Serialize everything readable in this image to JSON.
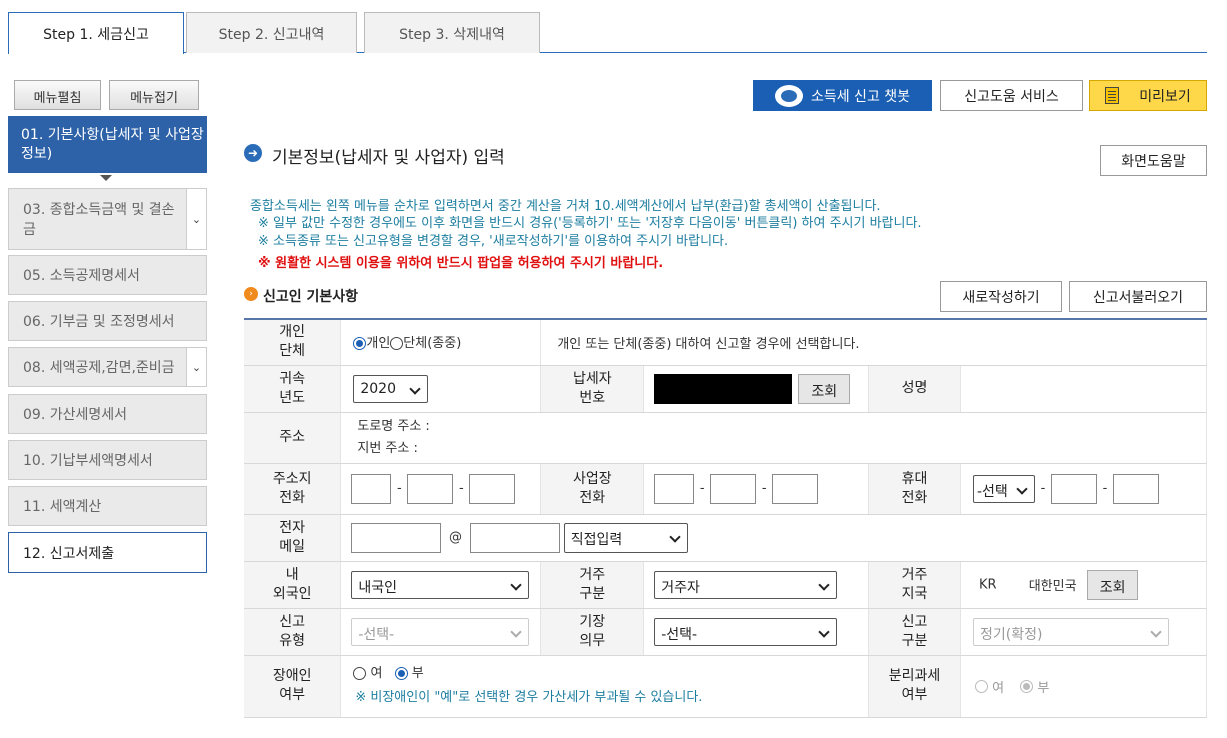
{
  "tabs": [
    "Step 1. 세금신고",
    "Step 2. 신고내역",
    "Step 3. 삭제내역"
  ],
  "menu_controls": {
    "expand": "메뉴펼침",
    "collapse": "메뉴접기"
  },
  "left_menu": [
    "01. 기본사항(납세자 및 사업장정보)",
    "03. 종합소득금액 및 결손금",
    "05. 소득공제명세서",
    "06. 기부금 및 조정명세서",
    "08. 세액공제,감면,준비금",
    "09. 가산세명세서",
    "10. 기납부세액명세서",
    "11. 세액계산",
    "12. 신고서제출"
  ],
  "top_buttons": {
    "chatbot": "소득세 신고 챗봇",
    "help_service": "신고도움 서비스",
    "preview": "미리보기"
  },
  "page_title": "기본정보(납세자 및 사업자) 입력",
  "screen_help": "화면도움말",
  "info_lines": [
    "종합소득세는 왼쪽 메뉴를 순차로 입력하면서 중간 계산을 거쳐 10.세액계산에서 납부(환급)할 총세액이 산출됩니다.",
    "※ 일부 값만 수정한 경우에도 이후 화면을 반드시 경유('등록하기' 또는 '저장후 다음이동' 버튼클릭) 하여 주시기 바랍니다.",
    "※ 소득종류 또는 신고유형을 변경할 경우, '새로작성하기'를 이용하여 주시기 바랍니다."
  ],
  "warning": "※ 원활한 시스템 이용을 위하여 반드시 팝업을 허용하여 주시기 바랍니다.",
  "section_title": "신고인 기본사항",
  "section_buttons": {
    "new": "새로작성하기",
    "load": "신고서불러오기"
  },
  "form": {
    "type_label": "개인\n단체",
    "type_individual": "개인",
    "type_group": "단체(종중)",
    "type_desc": "개인 또는 단체(종중) 대하여 신고할 경우에 선택합니다.",
    "year_label": "귀속\n년도",
    "year_value": "2020",
    "taxpayer_no_label": "납세자\n번호",
    "lookup": "조회",
    "name_label": "성명",
    "address_label": "주소",
    "road_address": "도로명 주소 :",
    "lot_address": "지번 주소 :",
    "addr_phone_label": "주소지\n전화",
    "biz_phone_label": "사업장\n전화",
    "mobile_label": "휴대\n전화",
    "mobile_select": "-선택",
    "email_label": "전자\n메일",
    "at": "@",
    "email_domain": "직접입력",
    "domestic_label": "내\n외국인",
    "domestic_value": "내국인",
    "residence_label": "거주\n구분",
    "residence_value": "거주자",
    "country_label": "거주\n지국",
    "country_code": "KR",
    "country_name": "대한민국",
    "report_type_label": "신고\n유형",
    "report_type_value": "-선택-",
    "bookkeeping_label": "기장\n의무",
    "bookkeeping_value": "-선택-",
    "report_kind_label": "신고\n구분",
    "report_kind_value": "정기(확정)",
    "disabled_label": "장애인\n여부",
    "yes": "여",
    "no": "부",
    "disabled_note": "※ 비장애인이 \"예\"로 선택한 경우 가산세가 부과될 수 있습니다.",
    "separate_tax_label": "분리과세\n여부"
  },
  "colors": {
    "primary_blue": "#2e62a8",
    "info_teal": "#1d7ea0",
    "warning_red": "#e01010",
    "preview_yellow": "#ffd84a"
  }
}
